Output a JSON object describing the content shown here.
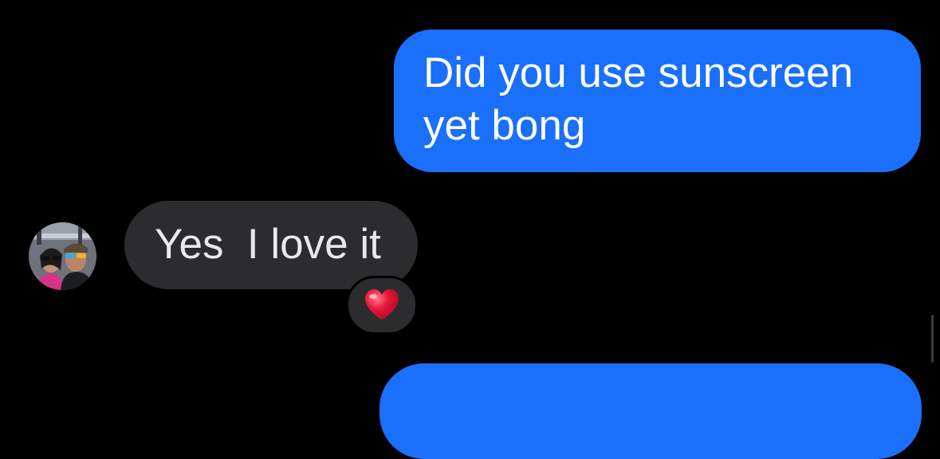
{
  "conversation": {
    "messages": [
      {
        "direction": "outgoing",
        "text": "Did you use sunscreen yet bong"
      },
      {
        "direction": "incoming",
        "text": "Yes  I love it",
        "sender_avatar": "avatar-photo",
        "reaction": "heart-icon"
      },
      {
        "direction": "outgoing",
        "text": ""
      }
    ]
  },
  "colors": {
    "background": "#000000",
    "outgoing_bubble": "#1a6ffb",
    "incoming_bubble": "#2c2c2e",
    "outgoing_text": "#ffffff",
    "incoming_text": "#e9e9eb",
    "reaction_heart": "#e8173a"
  }
}
